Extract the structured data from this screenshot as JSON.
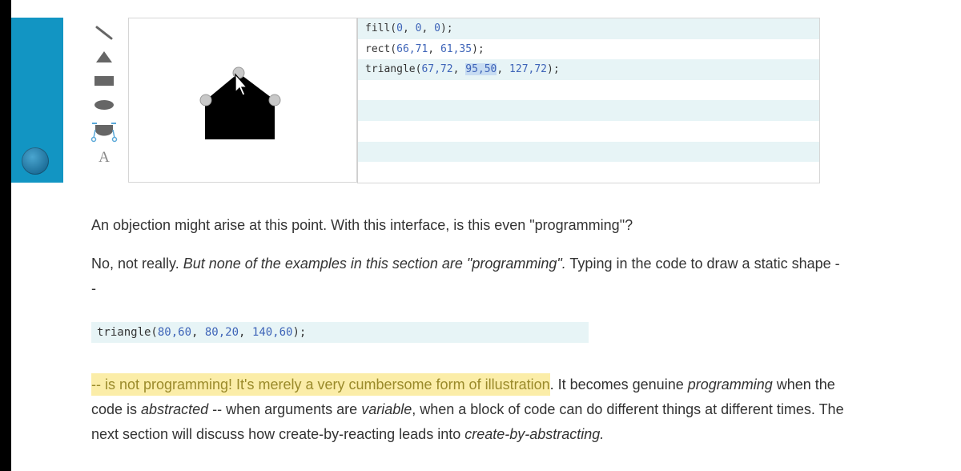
{
  "sidebar": {
    "accent_color": "#1295c3"
  },
  "tools": {
    "items": [
      {
        "name": "line-tool"
      },
      {
        "name": "triangle-tool"
      },
      {
        "name": "rectangle-tool"
      },
      {
        "name": "ellipse-tool"
      },
      {
        "name": "curve-tool"
      },
      {
        "name": "text-tool",
        "label": "A"
      }
    ]
  },
  "editor": {
    "lines": [
      {
        "fn": "fill(",
        "args": [
          "0",
          "0",
          "0"
        ],
        "end": ");"
      },
      {
        "fn": "rect(",
        "args": [
          "66,71",
          "61,35"
        ],
        "end": ");"
      },
      {
        "fn": "triangle(",
        "args": [
          "67,72",
          "95,50",
          "127,72"
        ],
        "end": ");",
        "selected_arg": "95,50"
      }
    ]
  },
  "article": {
    "p1": "An objection might arise at this point. With this interface, is this even \"programming\"?",
    "p2_a": "No, not really. ",
    "p2_b": "But none of the examples in this section are \"programming\".",
    "p2_c": " Typing in the code to draw a static shape --",
    "code": {
      "fn": "triangle(",
      "args": [
        "80,60",
        "80,20",
        "140,60"
      ],
      "end": ");"
    },
    "p3_highlight": "-- is not programming! It's merely a very cumbersome form of illustration",
    "p3_a": ". It becomes genuine ",
    "p3_b": "programming",
    "p3_c": " when the code is ",
    "p3_d": "abstracted",
    "p3_e": " -- when arguments are ",
    "p3_f": "variable",
    "p3_g": ", when a block of code can do different things at different times. The next section will discuss how create-by-reacting leads into ",
    "p3_h": "create-by-abstracting.",
    "highlight_color": "#fbeda8"
  }
}
